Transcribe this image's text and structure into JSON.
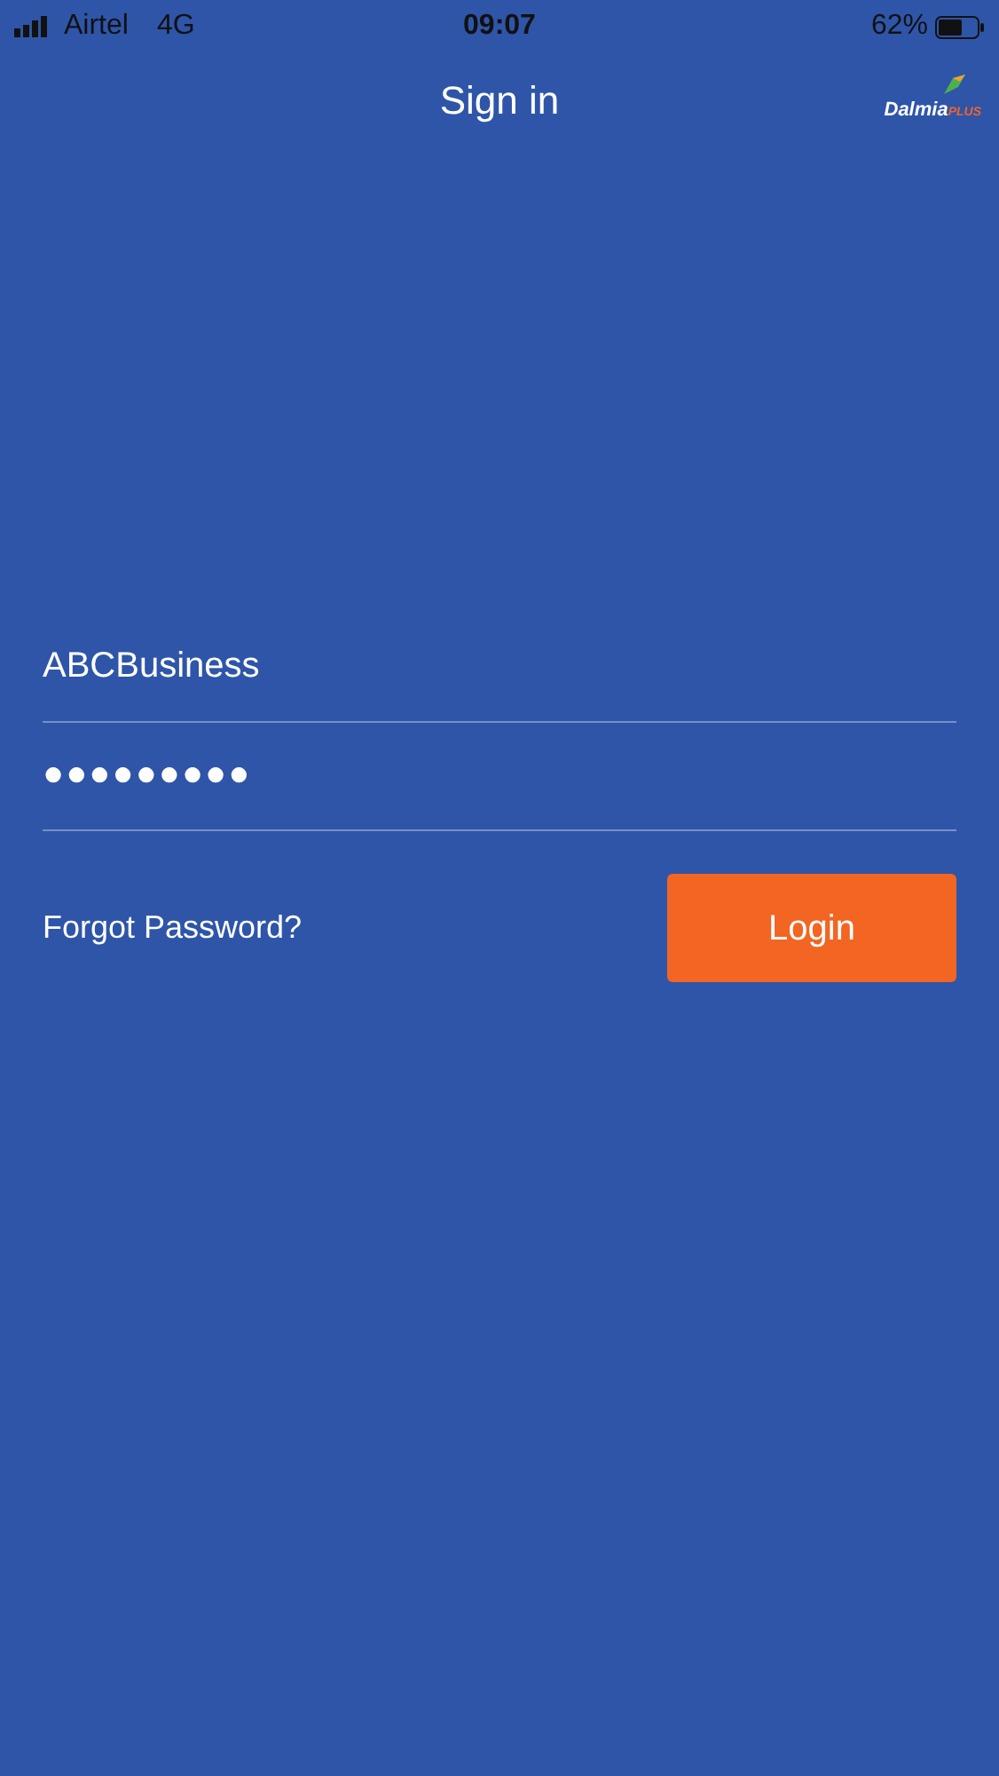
{
  "status_bar": {
    "carrier": "Airtel",
    "network": "4G",
    "time": "09:07",
    "battery": "62%"
  },
  "nav": {
    "title": "Sign in",
    "logo": {
      "name": "Dalmia",
      "suffix": "PLUS"
    }
  },
  "form": {
    "username": "ABCBusiness",
    "password": "●●●●●●●●●",
    "forgot_link": "Forgot Password?",
    "login_button": "Login"
  }
}
